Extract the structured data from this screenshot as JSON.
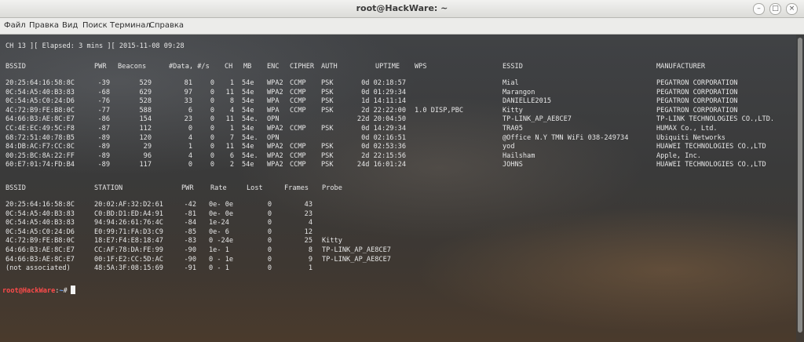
{
  "window": {
    "title": "root@HackWare: ~"
  },
  "menu": [
    "Файл",
    "Правка",
    "Вид",
    "Поиск",
    "Терминал",
    "Справка"
  ],
  "status_line": "CH 13 ][ Elapsed: 3 mins ][ 2015-11-08 09:28",
  "ap_headers": [
    "BSSID",
    "PWR",
    "Beacons",
    "#Data, #/s",
    "CH",
    "MB",
    "ENC",
    "CIPHER",
    "AUTH",
    "UPTIME",
    "WPS",
    "ESSID",
    "MANUFACTURER"
  ],
  "ap_rows": [
    [
      "20:25:64:16:58:8C",
      "-39",
      "529",
      "81",
      "0",
      "1",
      "54e",
      "WPA2",
      "CCMP",
      "PSK",
      "0d 02:18:57",
      "",
      "Mial",
      "PEGATRON CORPORATION"
    ],
    [
      "0C:54:A5:40:B3:83",
      "-68",
      "629",
      "97",
      "0",
      "11",
      "54e",
      "WPA2",
      "CCMP",
      "PSK",
      "0d 01:29:34",
      "",
      "Marangon",
      "PEGATRON CORPORATION"
    ],
    [
      "0C:54:A5:C0:24:D6",
      "-76",
      "528",
      "33",
      "0",
      "8",
      "54e",
      "WPA",
      "CCMP",
      "PSK",
      "1d 14:11:14",
      "",
      "DANIELLE2015",
      "PEGATRON CORPORATION"
    ],
    [
      "4C:72:B9:FE:B8:0C",
      "-77",
      "588",
      "6",
      "0",
      "4",
      "54e",
      "WPA",
      "CCMP",
      "PSK",
      "2d 22:22:00",
      "1.0 DISP,PBC",
      "Kitty",
      "PEGATRON CORPORATION"
    ],
    [
      "64:66:B3:AE:8C:E7",
      "-86",
      "154",
      "23",
      "0",
      "11",
      "54e.",
      "OPN",
      "",
      "",
      "22d 20:04:50",
      "",
      "TP-LINK_AP_AE8CE7",
      "TP-LINK TECHNOLOGIES CO.,LTD."
    ],
    [
      "CC:4E:EC:49:5C:F8",
      "-87",
      "112",
      "0",
      "0",
      "1",
      "54e",
      "WPA2",
      "CCMP",
      "PSK",
      "0d 14:29:34",
      "",
      "TRA05",
      "HUMAX Co., Ltd."
    ],
    [
      "68:72:51:40:78:B5",
      "-89",
      "120",
      "4",
      "0",
      "7",
      "54e.",
      "OPN",
      "",
      "",
      "0d 02:16:51",
      "",
      "@Office N.Y TMN WiFi 038-249734",
      "Ubiquiti Networks"
    ],
    [
      "84:DB:AC:F7:CC:8C",
      "-89",
      "29",
      "1",
      "0",
      "11",
      "54e",
      "WPA2",
      "CCMP",
      "PSK",
      "0d 02:53:36",
      "",
      "yod",
      "HUAWEI TECHNOLOGIES CO.,LTD"
    ],
    [
      "00:25:BC:8A:22:FF",
      "-89",
      "96",
      "4",
      "0",
      "6",
      "54e.",
      "WPA2",
      "CCMP",
      "PSK",
      "2d 22:15:56",
      "",
      "Hailsham",
      "Apple, Inc."
    ],
    [
      "60:E7:01:74:FD:B4",
      "-89",
      "117",
      "0",
      "0",
      "2",
      "54e",
      "WPA2",
      "CCMP",
      "PSK",
      "24d 16:01:24",
      "",
      "JOHNS",
      "HUAWEI TECHNOLOGIES CO.,LTD"
    ]
  ],
  "st_headers": [
    "BSSID",
    "STATION",
    "PWR",
    "Rate",
    "Lost",
    "Frames",
    "Probe"
  ],
  "st_rows": [
    [
      "20:25:64:16:58:8C",
      "20:02:AF:32:D2:61",
      "-42",
      "0e- 0e",
      "0",
      "43",
      ""
    ],
    [
      "0C:54:A5:40:B3:83",
      "C0:BD:D1:ED:A4:91",
      "-81",
      "0e- 0e",
      "0",
      "23",
      ""
    ],
    [
      "0C:54:A5:40:B3:83",
      "94:94:26:61:76:4C",
      "-84",
      "1e-24",
      "0",
      "4",
      ""
    ],
    [
      "0C:54:A5:C0:24:D6",
      "E0:99:71:FA:D3:C9",
      "-85",
      "0e- 6",
      "0",
      "12",
      ""
    ],
    [
      "4C:72:B9:FE:B8:0C",
      "18:E7:F4:E8:18:47",
      "-83",
      "0 -24e",
      "0",
      "25",
      "Kitty"
    ],
    [
      "64:66:B3:AE:8C:E7",
      "CC:AF:78:DA:FE:99",
      "-90",
      "1e- 1",
      "0",
      "8",
      "TP-LINK_AP_AE8CE7"
    ],
    [
      "64:66:B3:AE:8C:E7",
      "00:1F:E2:CC:5D:AC",
      "-90",
      "0 - 1e",
      "0",
      "9",
      "TP-LINK_AP_AE8CE7"
    ],
    [
      "(not associated)",
      "48:5A:3F:08:15:69",
      "-91",
      "0 - 1",
      "0",
      "1",
      ""
    ]
  ],
  "prompt": {
    "user_host": "root@HackWare",
    "sep": ":",
    "dir": "~",
    "symbol": "#"
  }
}
